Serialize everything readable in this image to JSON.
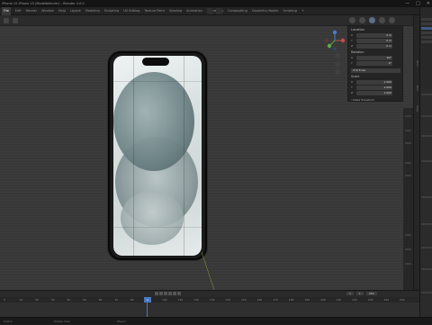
{
  "window": {
    "title": "iPhone 15 iPhone 15 (Modelbelinder) - Blender 4.0.0",
    "controls": [
      "—",
      "□",
      "✕"
    ]
  },
  "menubar": {
    "items": [
      "File",
      "Edit",
      "Render",
      "Window",
      "Help",
      "Layout",
      "Modeling",
      "Sculpting",
      "UV Editing",
      "Texture Paint",
      "Shading",
      "Animation",
      "Rendering",
      "Compositing",
      "Geometry Nodes",
      "Scripting",
      "+"
    ]
  },
  "npanel": {
    "section1": "Location",
    "rows1": [
      {
        "label": "X",
        "value": "0 m"
      },
      {
        "label": "Y",
        "value": "0 m"
      },
      {
        "label": "Z",
        "value": "0 m"
      }
    ],
    "section2": "Rotation",
    "rows2": [
      {
        "label": "X",
        "value": "90°"
      },
      {
        "label": "Y",
        "value": "0°"
      },
      {
        "label": "Z",
        "value": "0°"
      }
    ],
    "mode": "XYZ Euler",
    "section3": "Scale",
    "rows3": [
      {
        "label": "X",
        "value": "1.000"
      },
      {
        "label": "Y",
        "value": "1.000"
      },
      {
        "label": "Z",
        "value": "1.000"
      }
    ],
    "footer": "› Delta Transform"
  },
  "sidebar_tabs": [
    "Item",
    "Tool",
    "View"
  ],
  "timeline": {
    "current_frame": "1",
    "start": "1",
    "end": "250",
    "ruler": [
      "0",
      "10",
      "20",
      "30",
      "40",
      "50",
      "60",
      "70",
      "80",
      "90",
      "100",
      "110",
      "120",
      "130",
      "140",
      "150",
      "160",
      "170",
      "180",
      "190",
      "200",
      "210",
      "220",
      "230",
      "240",
      "250"
    ]
  },
  "statusbar": {
    "left": "Select",
    "middle": "Rotate View",
    "right": "Object"
  }
}
